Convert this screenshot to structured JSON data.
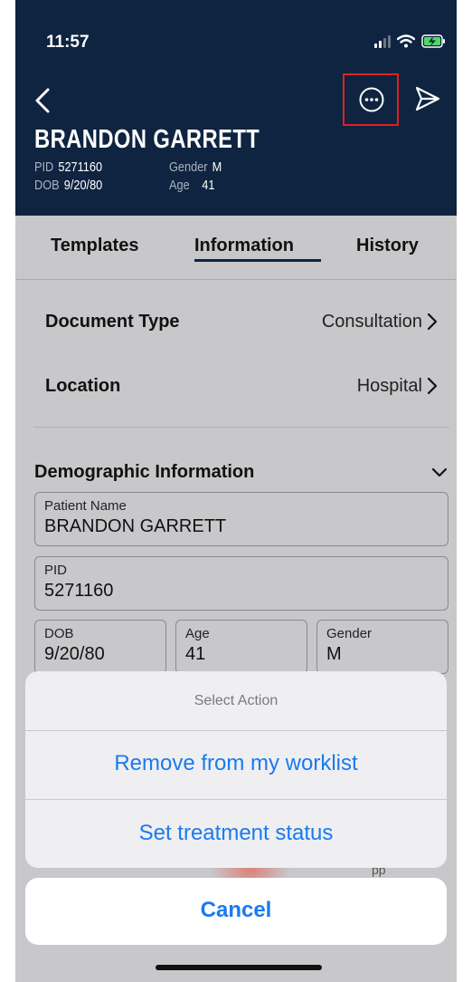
{
  "status_bar": {
    "time": "11:57"
  },
  "patient": {
    "name": "BRANDON GARRETT",
    "pid_label": "PID",
    "pid": "5271160",
    "gender_label": "Gender",
    "gender": "M",
    "dob_label": "DOB",
    "dob": "9/20/80",
    "age_label": "Age",
    "age": "41"
  },
  "tabs": [
    {
      "label": "Templates"
    },
    {
      "label": "Information",
      "selected": true
    },
    {
      "label": "History"
    }
  ],
  "rows": {
    "document_type": {
      "label": "Document Type",
      "value": "Consultation"
    },
    "location": {
      "label": "Location",
      "value": "Hospital"
    }
  },
  "demographics": {
    "title": "Demographic Information",
    "patient_name": {
      "label": "Patient Name",
      "value": "BRANDON GARRETT"
    },
    "pid": {
      "label": "PID",
      "value": "5271160"
    },
    "dob": {
      "label": "DOB",
      "value": "9/20/80"
    },
    "age": {
      "label": "Age",
      "value": "41"
    },
    "gender": {
      "label": "Gender",
      "value": "M"
    }
  },
  "action_sheet": {
    "title": "Select Action",
    "actions": [
      "Remove from my worklist",
      "Set treatment status"
    ],
    "cancel": "Cancel"
  },
  "partial_behind_text": "pp",
  "colors": {
    "header_bg": "#0e2440",
    "accent_blue": "#1a7af0",
    "highlight_red": "#e02020",
    "content_bg": "#c8c8cb"
  },
  "icons": [
    "back-chevron-icon",
    "more-options-icon",
    "send-icon",
    "chevron-right-icon",
    "chevron-down-icon",
    "signal-icon",
    "wifi-icon",
    "battery-charging-icon"
  ]
}
